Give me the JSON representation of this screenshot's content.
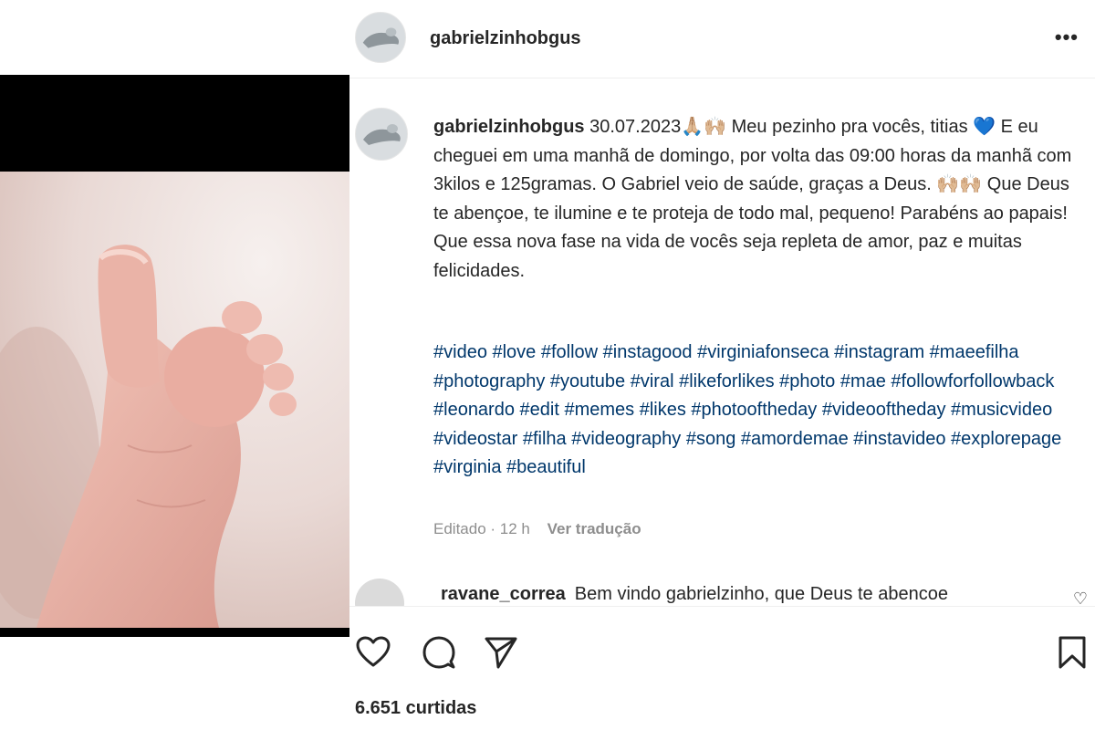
{
  "post": {
    "username": "gabrielzinhobgus",
    "more_icon": "more-horizontal-icon",
    "caption": {
      "username": "gabrielzinhobgus",
      "date": "30.07.2023",
      "emoji_pray": "🙏🏼",
      "emoji_raise": "🙌🏼",
      "emoji_heart": "💙",
      "text_part1": " Meu pezinho pra vocês, titias ",
      "text_part2": " E eu cheguei em uma manhã de domingo, por volta das 09:00 horas da manhã com 3kilos e 125gramas. O Gabriel veio de saúde, graças a Deus. ",
      "text_part3": " Que Deus te abençoe, te ilumine e te proteja de todo mal, pequeno! Parabéns ao papais! Que essa nova fase na vida de vocês seja repleta de amor, paz e muitas felicidades."
    },
    "hashtags": "#video #love #follow #instagood #virginiafonseca #instagram #maeefilha #photography #youtube #viral #likeforlikes #photo #mae #followforfollowback #leonardo #edit #memes #likes #photooftheday #videooftheday #musicvideo #videostar #filha #videography #song #amordemae #instavideo #explorepage #virginia #beautiful",
    "meta": {
      "edited": "Editado · 12 h",
      "translate": "Ver tradução"
    },
    "comment": {
      "username": "ravane_correa",
      "text": "Bem vindo gabrielzinho, que Deus te abencoe"
    },
    "likes": "6.651 curtidas"
  },
  "colors": {
    "hashtag": "#00376b",
    "muted": "#8e8e8e",
    "text": "#262626"
  }
}
